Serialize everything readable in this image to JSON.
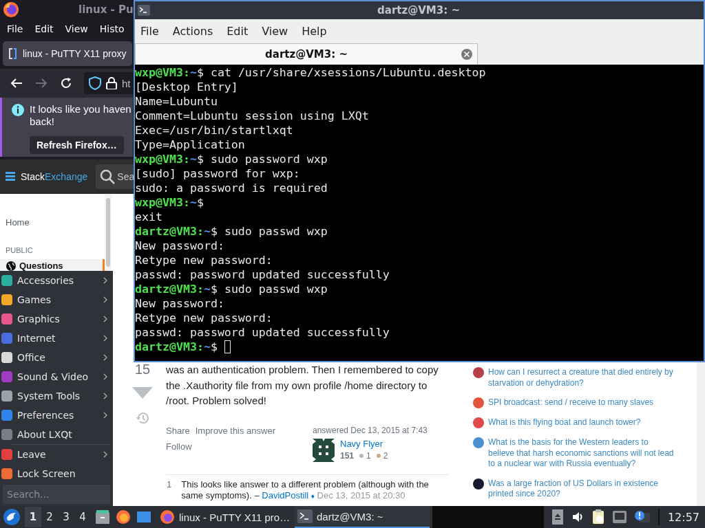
{
  "firefox": {
    "title": "linux - Pu",
    "menu": [
      "File",
      "Edit",
      "View",
      "Histo"
    ],
    "tab": {
      "title": "linux - PuTTY X11 proxy"
    },
    "address": {
      "text": "ht"
    },
    "notification": {
      "lines": [
        "It looks like you haven",
        "back!"
      ],
      "button": "Refresh Firefox…"
    },
    "site_header": {
      "logo": [
        "Stack",
        "Exchange"
      ],
      "search": {
        "placeholder": "Sea"
      }
    },
    "left_nav": [
      {
        "kind": "link",
        "label": "Home",
        "selected": false
      },
      {
        "kind": "heading",
        "label": "PUBLIC"
      },
      {
        "kind": "iconlink",
        "label": "Questions",
        "selected": true
      }
    ],
    "answer": {
      "votes": "15",
      "body": "was an authentication problem. Then I remembered to copy the .Xauthority file from my own profile /home directory to /root. Problem solved!",
      "actions": [
        "Share",
        "Improve this answer",
        "Follow"
      ],
      "answered": "answered Dec 13, 2015 at 7:43",
      "user": {
        "name": "Navy Flyer",
        "reputation": "151",
        "badges": [
          {
            "count": "1",
            "color": "#b4b8bc"
          },
          {
            "count": "2",
            "color": "#d1a684"
          }
        ]
      },
      "comments": [
        {
          "score": "1",
          "text": "This looks like answer to a different problem (although with the same symptoms). –",
          "author": "DavidPostill",
          "badge": "♦",
          "date": "Dec 13, 2015 at 20:30"
        }
      ]
    },
    "hot_questions": [
      {
        "title": "How can I resurrect a creature that died entirely by starvation or dehydration?",
        "color": "#b5404a"
      },
      {
        "title": "SPI broadcast: send / receive to many slaves",
        "color": "#e2553a"
      },
      {
        "title": "What is this flying boat and launch tower?",
        "color": "#e24a4a"
      },
      {
        "title": "What is the basis for the Western leaders to believe that harsh economic sanctions will not lead to a nuclear war with Russia eventually?",
        "color": "#4a90d0"
      },
      {
        "title": "Was a large fraction of US Dollars in existence printed since 2020?",
        "color": "#1a1a2e"
      }
    ]
  },
  "terminal": {
    "title": "dartz@VM3: ~",
    "menu": [
      "File",
      "Actions",
      "Edit",
      "View",
      "Help"
    ],
    "tab": {
      "title": "dartz@VM3: ~"
    },
    "lines": [
      {
        "kind": "prompt",
        "user": "wxp@VM3:",
        "path": "~",
        "symbol": "$",
        "command": "cat /usr/share/xsessions/Lubuntu.desktop"
      },
      {
        "kind": "output",
        "text": "[Desktop Entry]"
      },
      {
        "kind": "output",
        "text": "Name=Lubuntu"
      },
      {
        "kind": "output",
        "text": "Comment=Lubuntu session using LXQt"
      },
      {
        "kind": "output",
        "text": "Exec=/usr/bin/startlxqt"
      },
      {
        "kind": "output",
        "text": "Type=Application"
      },
      {
        "kind": "prompt",
        "user": "wxp@VM3:",
        "path": "~",
        "symbol": "$",
        "command": "sudo password wxp"
      },
      {
        "kind": "output",
        "text": "[sudo] password for wxp:"
      },
      {
        "kind": "output",
        "text": "sudo: a password is required"
      },
      {
        "kind": "prompt",
        "user": "wxp@VM3:",
        "path": "~",
        "symbol": "$"
      },
      {
        "kind": "output",
        "text": "exit"
      },
      {
        "kind": "prompt",
        "user": "dartz@VM3:",
        "path": "~",
        "symbol": "$",
        "command": "sudo passwd wxp"
      },
      {
        "kind": "output",
        "text": "New password:"
      },
      {
        "kind": "output",
        "text": "Retype new password:"
      },
      {
        "kind": "output",
        "text": "passwd: password updated successfully"
      },
      {
        "kind": "prompt",
        "user": "dartz@VM3:",
        "path": "~",
        "symbol": "$",
        "command": "sudo passwd wxp"
      },
      {
        "kind": "output",
        "text": "New password:"
      },
      {
        "kind": "output",
        "text": "Retype new password:"
      },
      {
        "kind": "output",
        "text": "passwd: password updated successfully"
      },
      {
        "kind": "prompt",
        "user": "dartz@VM3:",
        "path": "~",
        "symbol": "$",
        "cursor": true
      }
    ]
  },
  "app_menu": {
    "items": [
      {
        "label": "Accessories",
        "color": "#2bb0a0",
        "submenu": true
      },
      {
        "label": "Games",
        "color": "#f4a62a",
        "submenu": true
      },
      {
        "label": "Graphics",
        "color": "#e8558a",
        "submenu": true
      },
      {
        "label": "Internet",
        "color": "#4a6ee0",
        "submenu": true
      },
      {
        "label": "Office",
        "color": "#d8d8d8",
        "submenu": true
      },
      {
        "label": "Sound & Video",
        "color": "#a03cc0",
        "submenu": true
      },
      {
        "label": "System Tools",
        "color": "#9aa3ad",
        "submenu": true
      },
      {
        "label": "Preferences",
        "color": "#2f86e8",
        "submenu": true
      },
      {
        "label": "About LXQt",
        "color": "#7a7f86",
        "submenu": false
      }
    ],
    "session_items": [
      {
        "label": "Leave",
        "color": "#e0413f",
        "submenu": true
      },
      {
        "label": "Lock Screen",
        "color": "#f06a34",
        "submenu": false
      }
    ],
    "search": {
      "placeholder": "Search..."
    }
  },
  "taskbar": {
    "desktops": [
      {
        "label": "1",
        "selected": true
      },
      {
        "label": "2",
        "selected": false
      },
      {
        "label": "3",
        "selected": false
      },
      {
        "label": "4",
        "selected": false
      }
    ],
    "tasks": [
      {
        "kind": "browser",
        "title": "linux - PuTTY X11 pro…",
        "selected": false
      },
      {
        "kind": "terminal",
        "title": "dartz@VM3: ~",
        "selected": true
      }
    ],
    "clock": "12:57"
  }
}
